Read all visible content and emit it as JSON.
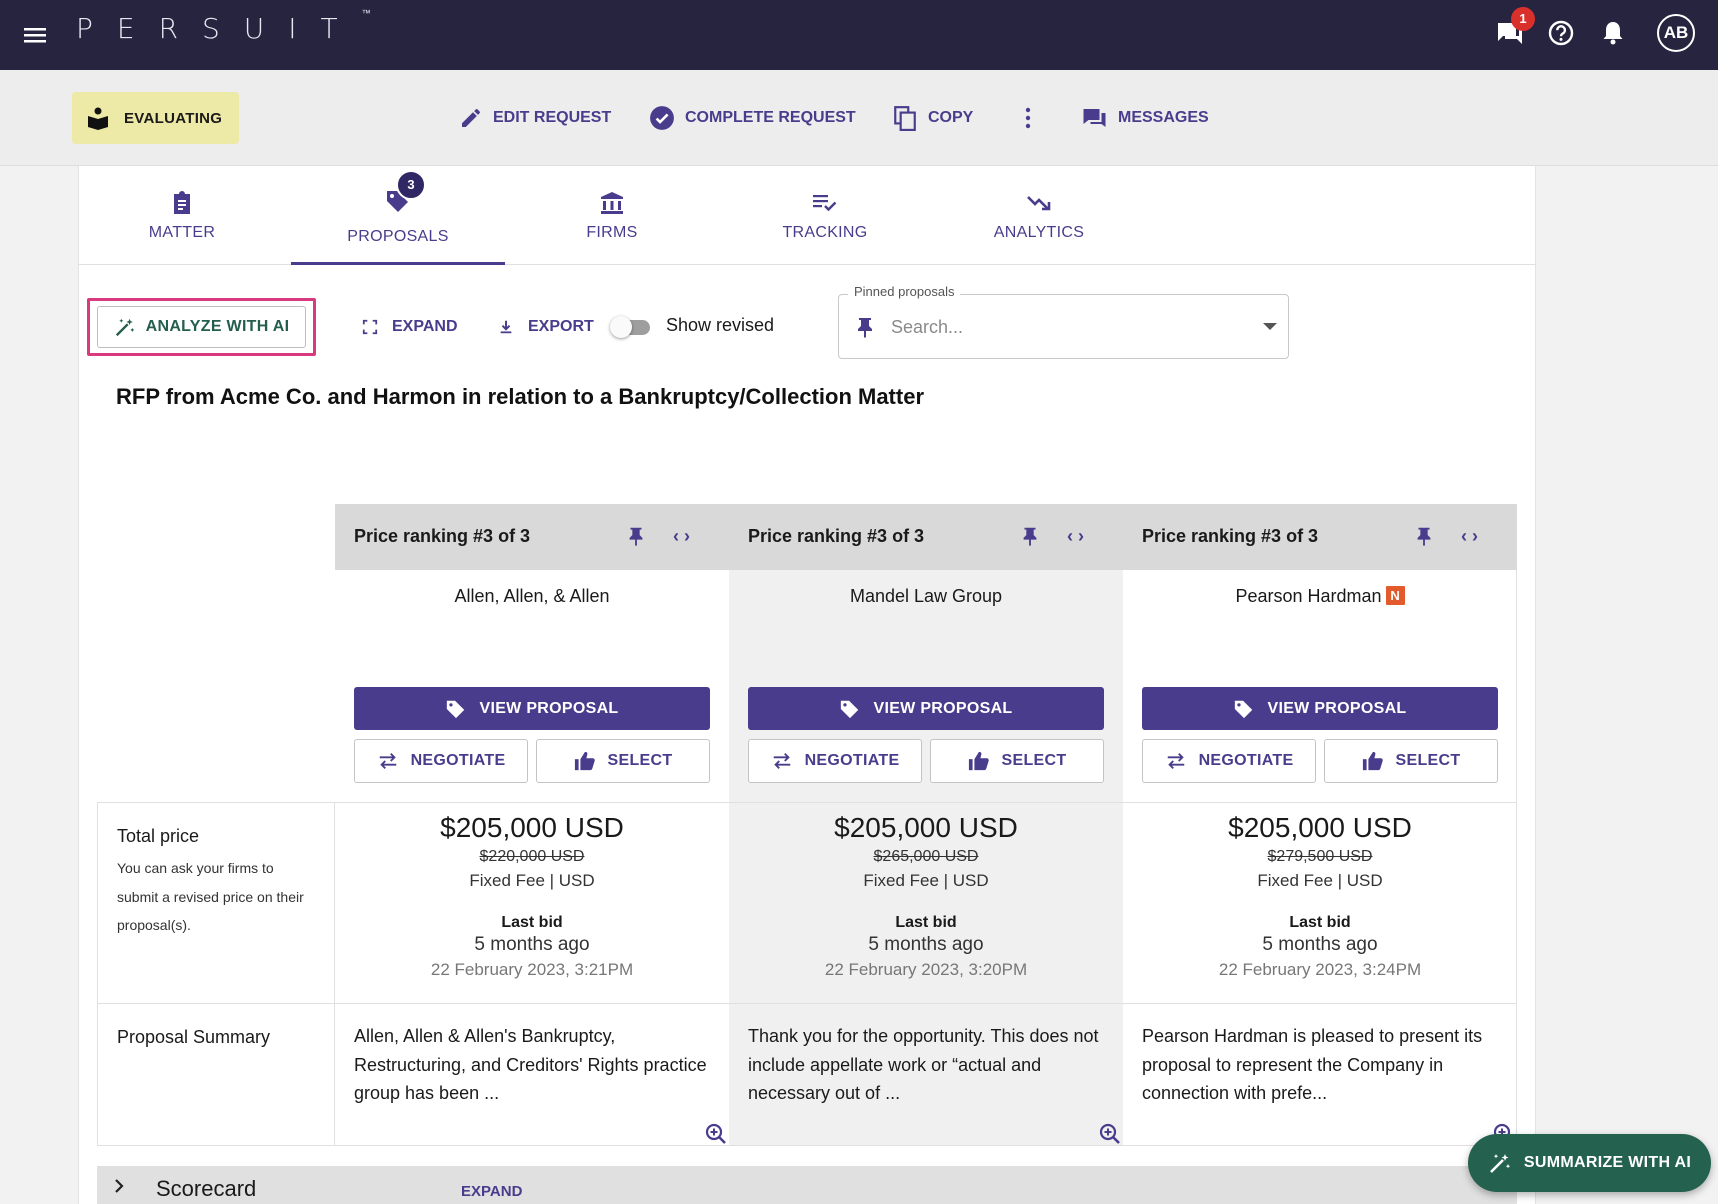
{
  "app": {
    "logo": "PERSUIT",
    "logo_tm": "™"
  },
  "topbar": {
    "chat_badge": "1",
    "avatar_initials": "AB"
  },
  "actions": {
    "status": "EVALUATING",
    "edit": "EDIT REQUEST",
    "complete": "COMPLETE REQUEST",
    "copy": "COPY",
    "messages": "MESSAGES"
  },
  "tabs": [
    {
      "label": "MATTER",
      "icon": "clipboard-icon"
    },
    {
      "label": "PROPOSALS",
      "icon": "tag-heart-icon",
      "badge": "3",
      "active": true
    },
    {
      "label": "FIRMS",
      "icon": "bank-icon"
    },
    {
      "label": "TRACKING",
      "icon": "list-check-icon"
    },
    {
      "label": "ANALYTICS",
      "icon": "trend-down-icon"
    }
  ],
  "toolbar": {
    "analyze": "ANALYZE WITH AI",
    "expand": "EXPAND",
    "export": "EXPORT",
    "show_revised": "Show revised",
    "show_revised_on": false,
    "pinned_label": "Pinned proposals",
    "pinned_placeholder": "Search..."
  },
  "rfp_title": "RFP from Acme Co. and Harmon in relation to a Bankruptcy/Collection Matter",
  "row_labels": {
    "total_price": "Total price",
    "total_note": "You can ask your firms to submit a revised price on their proposal(s).",
    "summary": "Proposal Summary"
  },
  "proposals": [
    {
      "ranking": "Price ranking #3 of 3",
      "firm": "Allen, Allen, & Allen",
      "new_badge": "",
      "view": "VIEW PROPOSAL",
      "negotiate": "NEGOTIATE",
      "select": "SELECT",
      "price": "$205,000 USD",
      "old_price": "$220,000 USD",
      "fee": "Fixed Fee | USD",
      "last_bid": "Last bid",
      "ago": "5 months ago",
      "date": "22 February 2023, 3:21PM",
      "summary": "Allen, Allen & Allen's Bankruptcy, Restructuring, and Creditors' Rights practice group has been ..."
    },
    {
      "ranking": "Price ranking #3 of 3",
      "firm": "Mandel Law Group",
      "new_badge": "",
      "view": "VIEW PROPOSAL",
      "negotiate": "NEGOTIATE",
      "select": "SELECT",
      "price": "$205,000 USD",
      "old_price": "$265,000 USD",
      "fee": "Fixed Fee | USD",
      "last_bid": "Last bid",
      "ago": "5 months ago",
      "date": "22 February 2023, 3:20PM",
      "summary": "Thank you for the opportunity. This does not include appellate work or “actual and necessary out of ..."
    },
    {
      "ranking": "Price ranking #3 of 3",
      "firm": "Pearson Hardman",
      "new_badge": "N",
      "view": "VIEW PROPOSAL",
      "negotiate": "NEGOTIATE",
      "select": "SELECT",
      "price": "$205,000 USD",
      "old_price": "$279,500 USD",
      "fee": "Fixed Fee | USD",
      "last_bid": "Last bid",
      "ago": "5 months ago",
      "date": "22 February 2023, 3:24PM",
      "summary": "Pearson Hardman is pleased to present its proposal to represent the Company in connection with prefe..."
    }
  ],
  "scorecard": {
    "title": "Scorecard",
    "expand": "EXPAND"
  },
  "fab": {
    "label": "SUMMARIZE WITH AI"
  },
  "colors": {
    "nav": "#27243f",
    "brand": "#4a3c8c",
    "status_chip": "#ede9a6",
    "ai_green": "#24624f",
    "highlight": "#d93a7f"
  }
}
